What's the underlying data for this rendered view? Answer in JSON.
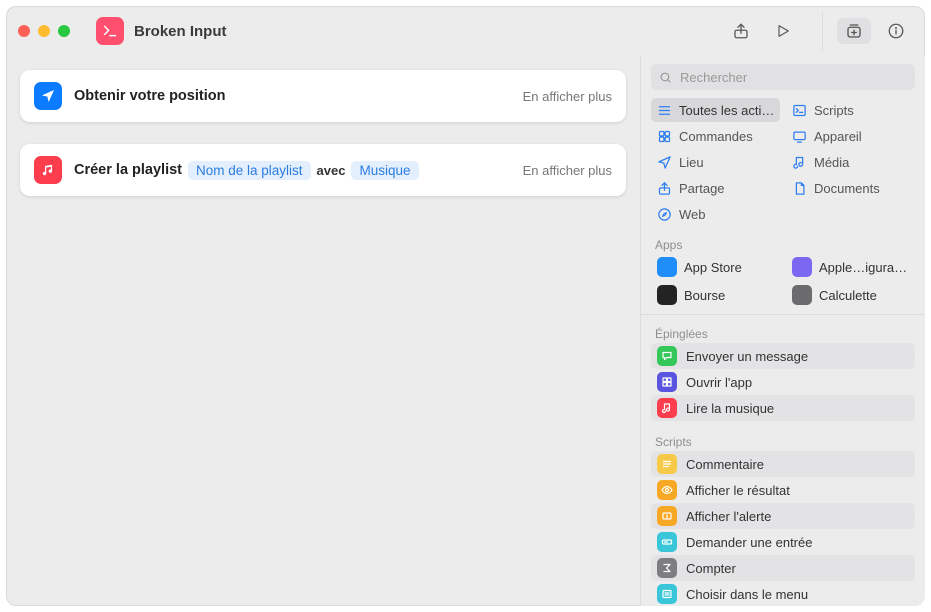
{
  "title": "Broken Input",
  "main": {
    "cards": [
      {
        "icon": "location-arrow",
        "icon_color": "blue",
        "title": "Obtenir votre position",
        "tokens": [],
        "show_more": "En afficher plus"
      },
      {
        "icon": "music-note",
        "icon_color": "red",
        "title": "Créer la playlist",
        "tokens": [
          {
            "type": "field",
            "text": "Nom de la playlist"
          },
          {
            "type": "text",
            "text": "avec"
          },
          {
            "type": "field",
            "text": "Musique"
          }
        ],
        "show_more": "En afficher plus"
      }
    ]
  },
  "sidebar": {
    "search_placeholder": "Rechercher",
    "categories": [
      {
        "label": "Toutes les acti…",
        "icon": "list",
        "selected": true
      },
      {
        "label": "Scripts",
        "icon": "terminal",
        "selected": false
      },
      {
        "label": "Commandes",
        "icon": "grid",
        "selected": false
      },
      {
        "label": "Appareil",
        "icon": "device",
        "selected": false
      },
      {
        "label": "Lieu",
        "icon": "location",
        "selected": false
      },
      {
        "label": "Média",
        "icon": "note",
        "selected": false
      },
      {
        "label": "Partage",
        "icon": "share",
        "selected": false
      },
      {
        "label": "Documents",
        "icon": "doc",
        "selected": false
      },
      {
        "label": "Web",
        "icon": "safari",
        "selected": false
      }
    ],
    "apps_title": "Apps",
    "apps": [
      {
        "label": "App Store",
        "color": "#1f8ef9"
      },
      {
        "label": "Apple…igurator",
        "color": "#7a67f2"
      },
      {
        "label": "Bourse",
        "color": "#232323"
      },
      {
        "label": "Calculette",
        "color": "#6b6b6e"
      }
    ],
    "pinned_title": "Épinglées",
    "pinned": [
      {
        "label": "Envoyer un message",
        "color": "#34c759",
        "icon": "bubble"
      },
      {
        "label": "Ouvrir l'app",
        "color": "#5a55e0",
        "icon": "grid"
      },
      {
        "label": "Lire la musique",
        "color": "#fb3d4e",
        "icon": "note"
      }
    ],
    "scripts_title": "Scripts",
    "scripts": [
      {
        "label": "Commentaire",
        "color": "#f7c948",
        "icon": "lines"
      },
      {
        "label": "Afficher le résultat",
        "color": "#f7a925",
        "icon": "eye"
      },
      {
        "label": "Afficher l'alerte",
        "color": "#f7a925",
        "icon": "alert"
      },
      {
        "label": "Demander une entrée",
        "color": "#39c6d9",
        "icon": "input"
      },
      {
        "label": "Compter",
        "color": "#7d7d82",
        "icon": "sum"
      },
      {
        "label": "Choisir dans le menu",
        "color": "#39c6d9",
        "icon": "menu"
      }
    ]
  }
}
